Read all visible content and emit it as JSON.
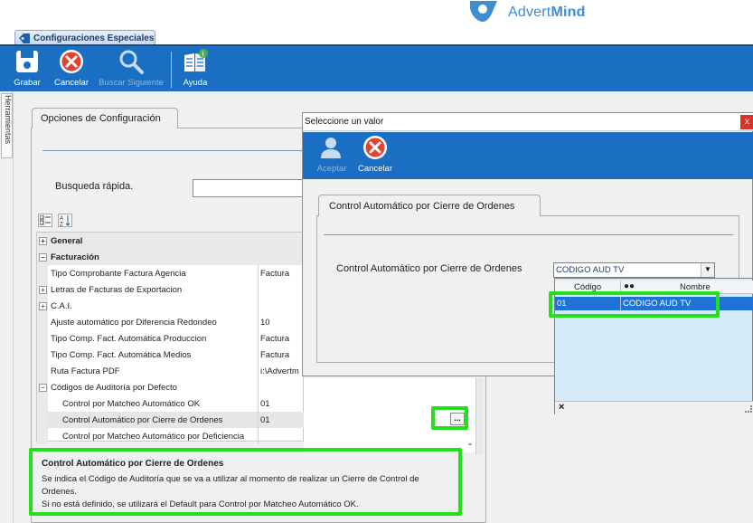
{
  "brand": {
    "name_plain": "Advert",
    "name_bold": "Mind"
  },
  "document_tab": {
    "label": "Configuraciones Especiales"
  },
  "toolbar": {
    "items": [
      {
        "label": "Grabar",
        "icon": "save-icon",
        "enabled": true
      },
      {
        "label": "Cancelar",
        "icon": "cancel-icon",
        "enabled": true
      },
      {
        "label": "Buscar Siguiente",
        "icon": "search-icon",
        "enabled": false
      },
      {
        "label": "Ayuda",
        "icon": "help-book-icon",
        "enabled": true
      }
    ]
  },
  "side_panel": {
    "label": "Herramientas"
  },
  "options": {
    "tab_label": "Opciones de Configuración",
    "quick_search_label": "Busqueda rápida.",
    "quick_search_value": ""
  },
  "property_grid": {
    "rows": [
      {
        "type": "category",
        "name": "General",
        "expander": "+"
      },
      {
        "type": "category",
        "name": "Facturación",
        "expander": "−"
      },
      {
        "type": "property",
        "name": "Tipo Comprobante Factura Agencia",
        "value": "Factura"
      },
      {
        "type": "group",
        "name": "Letras de Facturas de Exportacion",
        "value": "",
        "expander": "+"
      },
      {
        "type": "group",
        "name": "C.A.I.",
        "value": "",
        "expander": "+"
      },
      {
        "type": "property",
        "name": "Ajuste automático por Diferencia Redondeo",
        "value": "10"
      },
      {
        "type": "property",
        "name": "Tipo Comp. Fact. Automática Produccion",
        "value": "Factura"
      },
      {
        "type": "property",
        "name": "Tipo Comp. Fact. Automática Medios",
        "value": "Factura"
      },
      {
        "type": "property",
        "name": "Ruta Factura PDF",
        "value": "i:\\Advertm"
      },
      {
        "type": "group",
        "name": "Códigos de Auditoría por Defecto",
        "value": "",
        "expander": "−"
      },
      {
        "type": "child",
        "name": "Control por Matcheo Automático OK",
        "value": "01"
      },
      {
        "type": "child",
        "name": "Control Automático por Cierre de Ordenes",
        "value": "01",
        "selected": true
      },
      {
        "type": "child",
        "name": "Control por Matcheo Automático por Deficiencia",
        "value": ""
      }
    ],
    "ellipsis_button": "..."
  },
  "description": {
    "title": "Control Automático por Cierre de Ordenes",
    "line1": "Se indica el Código de Auditoría que se va a utilizar al momento de realizar un Cierre de Control de",
    "line2": "Ordenes.",
    "line3": "Si no está definido, se utilizará el Default para Control por Matcheo Automático OK."
  },
  "dialog": {
    "title": "Seleccione un valor",
    "close": "x",
    "toolbar": [
      {
        "label": "Aceptar",
        "icon": "user-accept-icon",
        "enabled": false
      },
      {
        "label": "Cancelar",
        "icon": "cancel-icon",
        "enabled": true
      }
    ],
    "tab_label": "Control Automático por Cierre de Ordenes",
    "field_label": "Control Automático por Cierre de Ordenes",
    "combo_value": "CODIGO AUD TV",
    "dropdown": {
      "columns": [
        "Código",
        "Nombre"
      ],
      "rows": [
        {
          "code": "01",
          "name": "CODIGO AUD TV"
        }
      ],
      "footer_clear": "×"
    }
  },
  "colors": {
    "toolbar": "#1a6fc2",
    "highlight": "#22e01a",
    "selection": "#1f72d6",
    "brand": "#3f8ccf"
  }
}
